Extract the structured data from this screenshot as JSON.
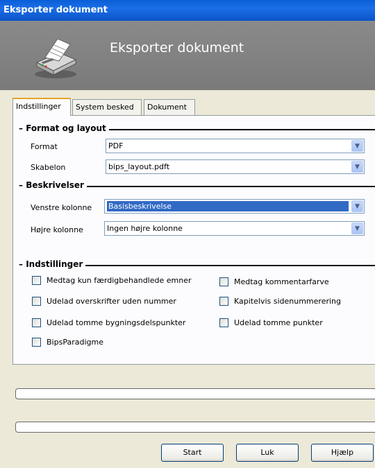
{
  "window": {
    "title": "Eksporter dokument"
  },
  "header": {
    "title": "Eksporter dokument",
    "icon": "printer-icon"
  },
  "tabs": [
    {
      "label": "Indstillinger",
      "active": true
    },
    {
      "label": "System besked",
      "active": false
    },
    {
      "label": "Dokument",
      "active": false
    }
  ],
  "format_layout": {
    "title": "Format og layout",
    "format_label": "Format",
    "format_value": "PDF",
    "template_label": "Skabelon",
    "template_value": "bips_layout.pdft"
  },
  "descriptions": {
    "title": "Beskrivelser",
    "left_label": "Venstre kolonne",
    "left_value": "Basisbeskrivelse",
    "right_label": "Højre kolonne",
    "right_value": "Ingen højre kolonne"
  },
  "settings": {
    "title": "Indstillinger",
    "options": [
      {
        "label": "Medtag kun færdigbehandlede emner",
        "checked": false
      },
      {
        "label": "Medtag kommentarfarve",
        "checked": false
      },
      {
        "label": "Udelad overskrifter uden nummer",
        "checked": false
      },
      {
        "label": "Kapitelvis sidenummerering",
        "checked": false
      },
      {
        "label": "Udelad tomme bygningsdelspunkter",
        "checked": false
      },
      {
        "label": "Udelad tomme punkter",
        "checked": false
      },
      {
        "label": "BipsParadigme",
        "checked": false
      }
    ]
  },
  "buttons": {
    "start": "Start",
    "close": "Luk",
    "help": "Hjælp"
  },
  "colors": {
    "titlebar": "#0a5fd8",
    "banner": "#808080",
    "selection": "#316ac5",
    "tab_accent": "#e8a227"
  }
}
